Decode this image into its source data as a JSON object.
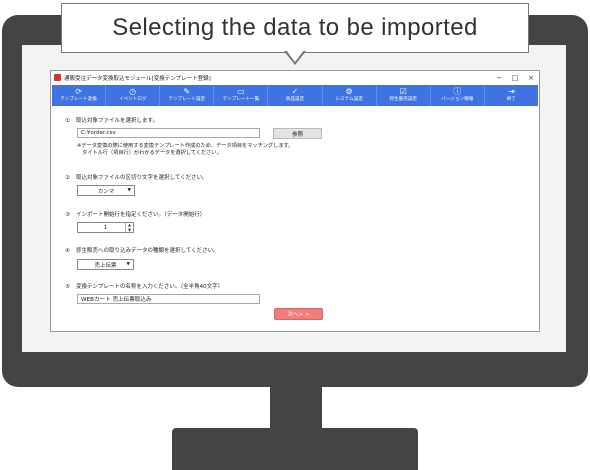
{
  "callout": {
    "text": "Selecting the data to be imported"
  },
  "window": {
    "title": "通販受注データ変換取込モジュール[変換テンプレート登録]",
    "controls": [
      "−",
      "□",
      "×"
    ]
  },
  "toolbar": {
    "items": [
      {
        "label": "テンプレート変換",
        "icon": "refresh-icon",
        "glyph": "⟳"
      },
      {
        "label": "イベントログ",
        "icon": "clock-icon",
        "glyph": "◷"
      },
      {
        "label": "テンプレート設定",
        "icon": "edit-icon",
        "glyph": "✎"
      },
      {
        "label": "テンプレート一覧",
        "icon": "list-icon",
        "glyph": "▭"
      },
      {
        "label": "商品設定",
        "icon": "check-icon",
        "glyph": "✓"
      },
      {
        "label": "システム設定",
        "icon": "gear-icon",
        "glyph": "⚙"
      },
      {
        "label": "弥生販売設定",
        "icon": "check-box-icon",
        "glyph": "☑"
      },
      {
        "label": "バージョン情報",
        "icon": "info-icon",
        "glyph": "ⓘ"
      },
      {
        "label": "終了",
        "icon": "exit-icon",
        "glyph": "⇥"
      }
    ]
  },
  "form": {
    "step1": {
      "num": "①",
      "label": "取込対象ファイルを選択します。",
      "path": "C:¥order.csv",
      "browse_label": "参照",
      "note_line1": "※データ変換の際に使用する変換テンプレート作成のため、データ項目をマッチングします。",
      "note_line2": "タイトル行（項目行）がわかるデータを選択してください。"
    },
    "step2": {
      "num": "②",
      "label": "取込対象ファイルの区切り文字を選択してください。",
      "value": "カンマ"
    },
    "step3": {
      "num": "③",
      "label": "インポート開始行を指定ください。（データ開始行）",
      "value": "1"
    },
    "step4": {
      "num": "④",
      "label": "弥生販売への取り込みデータの種類を選択してください。",
      "value": "売上伝票"
    },
    "step5": {
      "num": "⑤",
      "label": "変換テンプレートの名称を入力ください。（全半角40文字）",
      "value": "WEBカート 売上伝票取込み"
    },
    "next_label": "次へ> >"
  }
}
